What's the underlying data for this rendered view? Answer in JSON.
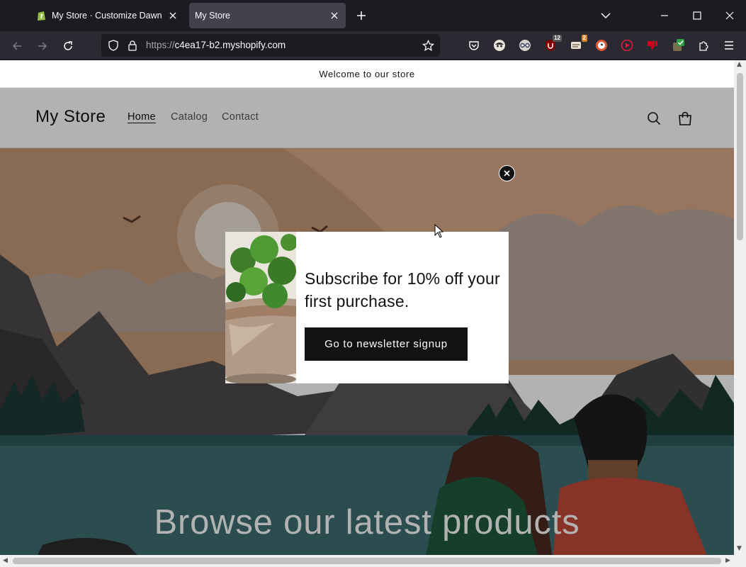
{
  "browser": {
    "tabs": [
      {
        "title": "My Store · Customize Dawn · Sh",
        "active": false
      },
      {
        "title": "My Store",
        "active": true
      }
    ],
    "url": {
      "scheme": "https://",
      "host": "c4ea17-b2.myshopify.com"
    },
    "extensions": [
      {
        "name": "pocket-icon"
      },
      {
        "name": "extension-avatar-icon"
      },
      {
        "name": "extension-glasses-icon"
      },
      {
        "name": "ublock-icon",
        "badge": "12",
        "badge_color": "#555555"
      },
      {
        "name": "extension-stack-icon",
        "badge": "2",
        "badge_color": "#d9822b"
      },
      {
        "name": "duckduckgo-icon"
      },
      {
        "name": "extension-play-icon"
      },
      {
        "name": "extension-thumb-icon"
      },
      {
        "name": "extension-check-icon"
      },
      {
        "name": "extensions-puzzle-icon"
      },
      {
        "name": "app-menu-icon"
      }
    ]
  },
  "store": {
    "announcement": "Welcome to our store",
    "logo": "My Store",
    "menu": [
      "Home",
      "Catalog",
      "Contact"
    ],
    "active_menu": "Home",
    "hero_heading": "Browse our latest products"
  },
  "popup": {
    "heading": "Subscribe for 10% off your first purchase.",
    "button_label": "Go to newsletter signup"
  },
  "colors": {
    "chrome_dark": "#1c1b22",
    "button_black": "#121212",
    "sky": "#c39a7a",
    "water": "#3f6f72"
  }
}
